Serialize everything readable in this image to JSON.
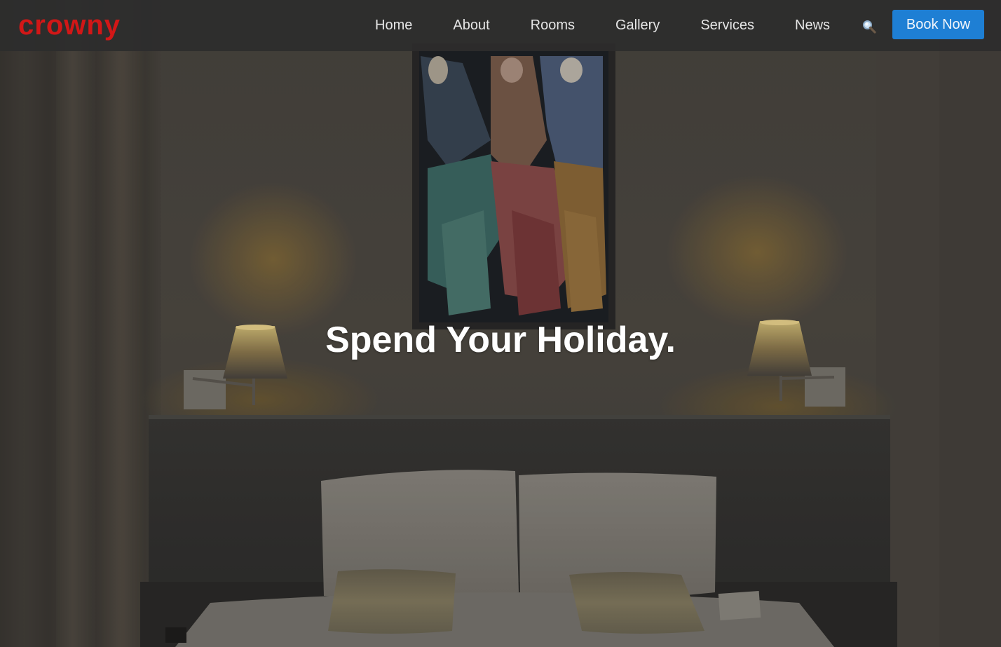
{
  "brand": {
    "logo_text": "crowny",
    "logo_color": "#d21717"
  },
  "nav": {
    "items": [
      {
        "label": "Home"
      },
      {
        "label": "About"
      },
      {
        "label": "Rooms"
      },
      {
        "label": "Gallery"
      },
      {
        "label": "Services"
      },
      {
        "label": "News"
      }
    ],
    "search_icon": "search-icon",
    "book_label": "Book Now",
    "book_color": "#1e7fd4"
  },
  "hero": {
    "headline": "Spend Your Holiday."
  }
}
